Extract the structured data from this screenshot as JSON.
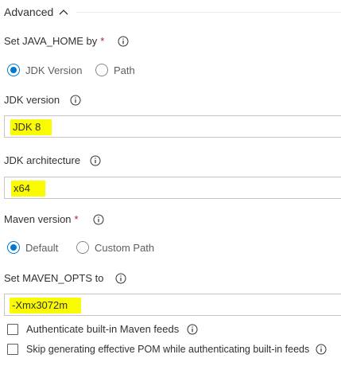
{
  "advanced": {
    "title": "Advanced"
  },
  "java_home": {
    "label": "Set JAVA_HOME by",
    "required_mark": "*",
    "options": [
      "JDK Version",
      "Path"
    ],
    "selected": "JDK Version"
  },
  "jdk_version": {
    "label": "JDK version",
    "value": "JDK 8"
  },
  "jdk_architecture": {
    "label": "JDK architecture",
    "value": "x64"
  },
  "maven_version": {
    "label": "Maven version",
    "required_mark": "*",
    "options": [
      "Default",
      "Custom Path"
    ],
    "selected": "Default"
  },
  "maven_opts": {
    "label": "Set MAVEN_OPTS to",
    "value": "-Xmx3072m"
  },
  "checkboxes": [
    {
      "label": "Authenticate built-in Maven feeds",
      "checked": false
    },
    {
      "label": "Skip generating effective POM while authenticating built-in feeds",
      "checked": false
    }
  ],
  "colors": {
    "accent": "#0078d4",
    "required": "#a4262c",
    "highlight": "#fafa00"
  },
  "icons": [
    "chevron-up-icon",
    "info-icon"
  ]
}
